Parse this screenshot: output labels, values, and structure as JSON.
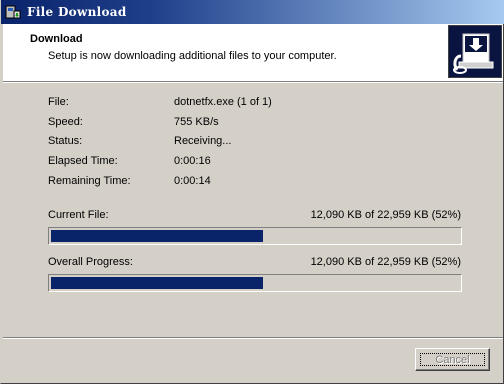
{
  "window": {
    "title": "File Download",
    "icon": "setup-icon",
    "colors": {
      "title_start": "#0a246a",
      "title_end": "#a6caf0",
      "face": "#d4d0c8",
      "progress_fill": "#0a246a"
    }
  },
  "header": {
    "heading": "Download",
    "subheading": "Setup is now downloading additional files to your computer.",
    "graphic_icon": "download-computer-icon"
  },
  "details": [
    {
      "label": "File:",
      "value": "dotnetfx.exe (1 of 1)"
    },
    {
      "label": "Speed:",
      "value": "755 KB/s"
    },
    {
      "label": "Status:",
      "value": "Receiving..."
    },
    {
      "label": "Elapsed Time:",
      "value": "0:00:16"
    },
    {
      "label": "Remaining Time:",
      "value": "0:00:14"
    }
  ],
  "current_file": {
    "label": "Current File:",
    "status": "12,090 KB of 22,959 KB (52%)",
    "progress": 0.52
  },
  "overall": {
    "label": "Overall Progress:",
    "status": "12,090 KB of 22,959 KB (52%)",
    "progress": 0.52
  },
  "buttons": {
    "cancel": "Cancel"
  }
}
